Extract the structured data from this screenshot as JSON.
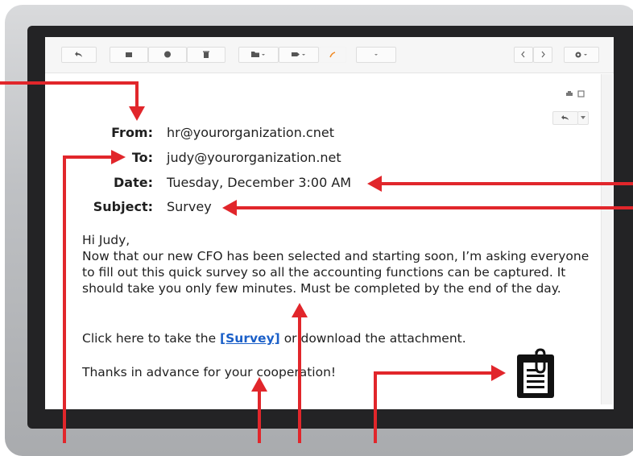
{
  "email": {
    "from_label": "From:",
    "from_value": "hr@yourorganization.cnet",
    "to_label": "To:",
    "to_value": "judy@yourorganization.net",
    "date_label": "Date:",
    "date_value": "Tuesday, December 3:00 AM",
    "subject_label": "Subject:",
    "subject_value": "Survey",
    "greeting": "Hi Judy,",
    "paragraph1": "Now that our new CFO has been selected and starting soon, I’m asking everyone to fill out this quick survey so all the accounting functions can be captured. It should take you only few minutes. Must be completed by the end of the day.",
    "click_prefix": "Click here to take the ",
    "link_text": "[Survey]",
    "click_suffix": " or download the attachment.",
    "thanks": "Thanks in advance for your cooperation!"
  },
  "toolbar": {
    "icons": [
      "back-arrow-icon",
      "archive-icon",
      "spam-icon",
      "trash-icon",
      "folder-icon",
      "label-icon",
      "more-icon",
      "prev-icon",
      "next-icon",
      "settings-icon"
    ]
  },
  "colors": {
    "annotation_red": "#e1262b",
    "link_blue": "#1a5fc8",
    "frame_dark": "#232325"
  }
}
